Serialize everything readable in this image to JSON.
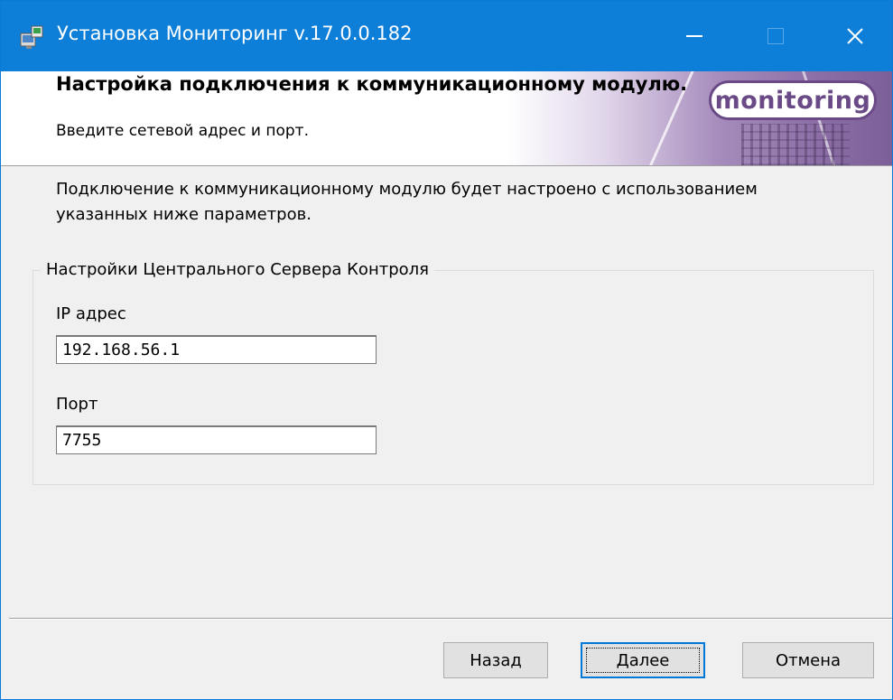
{
  "window": {
    "title": "Установка Мониторинг v.17.0.0.182",
    "icon": "installer-icon",
    "controls": {
      "minimize": "—",
      "maximize": "☐",
      "close": "✕"
    }
  },
  "header": {
    "title": "Настройка подключения к коммуникационному модулю.",
    "subtitle": "Введите сетевой адрес и порт.",
    "logo_text": "monitoring"
  },
  "description": "Подключение к коммуникационному модулю будет настроено с использованием указанных ниже параметров.",
  "group": {
    "legend": "Настройки Центрального Сервера Контроля",
    "ip_label": "IP адрес",
    "ip_value": "192.168.56.1",
    "port_label": "Порт",
    "port_value": "7755"
  },
  "buttons": {
    "back": "Назад",
    "next": "Далее",
    "cancel": "Отмена"
  },
  "colors": {
    "titlebar": "#0e7fd9",
    "accent": "#0078d7",
    "logo": "#6a4a86"
  }
}
